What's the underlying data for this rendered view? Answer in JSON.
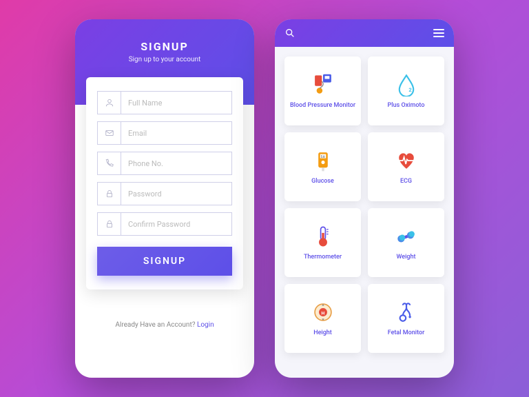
{
  "signup": {
    "title": "SIGNUP",
    "subtitle": "Sign up to your account",
    "fields": {
      "fullname": {
        "placeholder": "Full Name",
        "icon": "user-icon"
      },
      "email": {
        "placeholder": "Email",
        "icon": "mail-icon"
      },
      "phone": {
        "placeholder": "Phone No.",
        "icon": "phone-icon"
      },
      "password": {
        "placeholder": "Password",
        "icon": "lock-icon"
      },
      "confirm": {
        "placeholder": "Confirm Password",
        "icon": "lock-icon"
      }
    },
    "button": "SIGNUP",
    "footer_text": "Already Have an Account? ",
    "footer_link": "Login"
  },
  "dashboard": {
    "tiles": [
      {
        "label": "Blood Pressure Monitor",
        "icon": "bp-monitor"
      },
      {
        "label": "Plus Oximoto",
        "icon": "oxygen"
      },
      {
        "label": "Glucose",
        "icon": "glucose"
      },
      {
        "label": "ECG",
        "icon": "ecg"
      },
      {
        "label": "Thermometer",
        "icon": "thermometer"
      },
      {
        "label": "Weight",
        "icon": "weight"
      },
      {
        "label": "Height",
        "icon": "height"
      },
      {
        "label": "Fetal Monitor",
        "icon": "fetal"
      }
    ]
  },
  "colors": {
    "primary": "#5d4fe8",
    "accent": "#7b3fe4"
  }
}
